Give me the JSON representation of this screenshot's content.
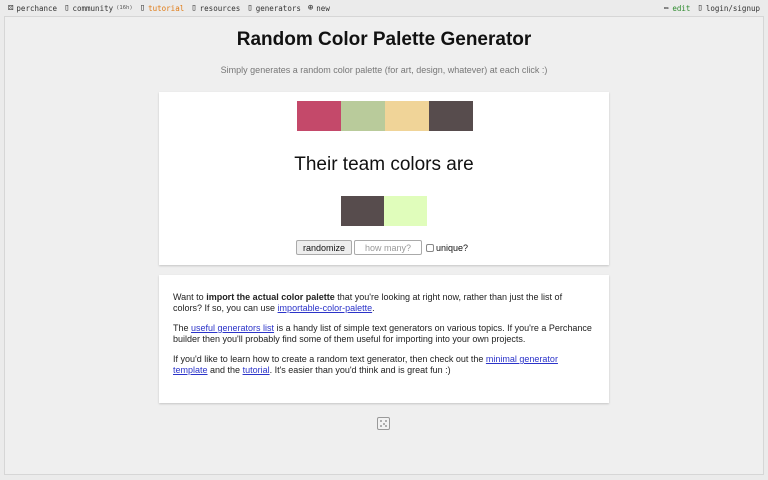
{
  "topbar": {
    "perchance": "perchance",
    "community": "community",
    "community_count": "(16h)",
    "tutorial": "tutorial",
    "resources": "resources",
    "generators": "generators",
    "new": "new",
    "edit": "edit",
    "login": "login/signup"
  },
  "page": {
    "title": "Random Color Palette Generator",
    "subtitle": "Simply generates a random color palette (for art, design, whatever) at each click :)"
  },
  "result": {
    "palette": [
      "#c4496a",
      "#b9cb9b",
      "#f0d498",
      "#574c4d"
    ],
    "team_text": "Their team colors are",
    "team_palette": [
      "#574c4d",
      "#e0fdbb"
    ]
  },
  "controls": {
    "randomize": "randomize",
    "count_placeholder": "how many?",
    "unique_label": "unique?"
  },
  "info": {
    "p1_a": "Want to ",
    "p1_bold": "import the actual color palette",
    "p1_b": " that you're looking at right now, rather than just the list of colors? If so, you can use ",
    "p1_link": "importable-color-palette",
    "p1_c": ".",
    "p2_a": "The ",
    "p2_link": "useful generators list",
    "p2_b": " is a handy list of simple text generators on various topics. If you're a Perchance builder then you'll probably find some of them useful for importing into your own projects.",
    "p3_a": "If you'd like to learn how to create a random text generator, then check out the ",
    "p3_link1": "minimal generator template",
    "p3_b": " and the ",
    "p3_link2": "tutorial",
    "p3_c": ". It's easier than you'd think and is great fun :)"
  },
  "icons": {
    "logo": "dice-icon",
    "community": "people-icon",
    "tutorial": "book-icon",
    "resources": "link-icon",
    "generators": "list-icon",
    "new": "plus-circle-icon",
    "edit": "pencil-icon",
    "login": "user-icon",
    "footer": "dice-icon"
  }
}
